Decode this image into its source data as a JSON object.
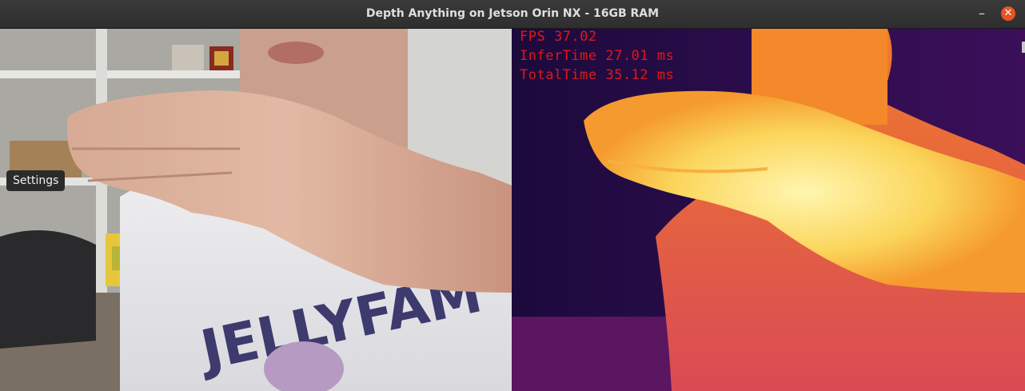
{
  "window": {
    "title": "Depth Anything on Jetson Orin NX - 16GB RAM",
    "minimize_glyph": "–",
    "close_glyph": "✕",
    "accent_color": "#e95420"
  },
  "left_pane": {
    "shirt_text": "JELLYFAM"
  },
  "right_pane": {
    "colormap": "inferno",
    "stats": [
      {
        "label": "FPS 37.02"
      },
      {
        "label": "InferTime 27.01 ms"
      },
      {
        "label": "TotalTime 35.12 ms"
      }
    ]
  },
  "tooltip": {
    "text": "Settings"
  }
}
